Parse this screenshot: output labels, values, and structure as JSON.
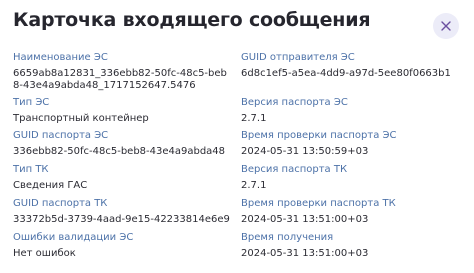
{
  "dialog": {
    "title": "Карточка входящего сообщения",
    "close_icon": "close-icon"
  },
  "fields": {
    "left": [
      {
        "label": "Наименование ЭС",
        "value": "6659ab8a12831_336ebb82-50fc-48c5-beb8-43e4a9abda48_1717152647.5476"
      },
      {
        "label": "Тип ЭС",
        "value": "Транспортный контейнер"
      },
      {
        "label": "GUID паспорта ЭС",
        "value": "336ebb82-50fc-48c5-beb8-43e4a9abda48"
      },
      {
        "label": "Тип ТК",
        "value": "Сведения ГАС"
      },
      {
        "label": "GUID паспорта ТК",
        "value": "33372b5d-3739-4aad-9e15-42233814e6e9"
      },
      {
        "label": "Ошибки валидации ЭС",
        "value": "Нет ошибок"
      }
    ],
    "right": [
      {
        "label": "GUID отправителя ЭС",
        "value": "6d8c1ef5-a5ea-4dd9-a97d-5ee80f0663b1"
      },
      {
        "label": "Версия паспорта ЭС",
        "value": "2.7.1"
      },
      {
        "label": "Время проверки паспорта ЭС",
        "value": "2024-05-31 13:50:59+03"
      },
      {
        "label": "Версия паспорта ТК",
        "value": "2.7.1"
      },
      {
        "label": "Время проверки паспорта ТК",
        "value": "2024-05-31 13:51:00+03"
      },
      {
        "label": "Время получения",
        "value": "2024-05-31 13:51:00+03"
      }
    ]
  },
  "colors": {
    "label": "#4d72a8",
    "value": "#2b2b33",
    "close_bg": "#ececf8",
    "close_glyph": "#6b4fa0"
  }
}
